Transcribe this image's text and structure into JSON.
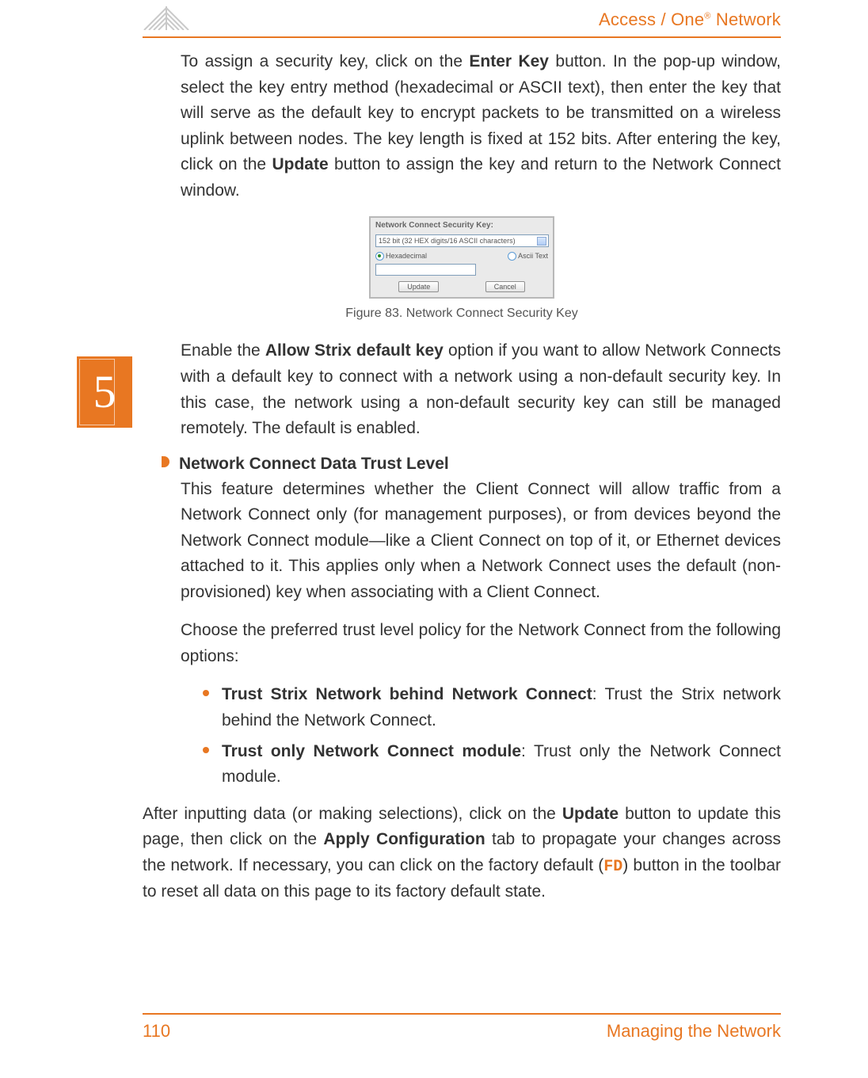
{
  "header": {
    "brand_pre": "Access / One",
    "brand_sup": "®",
    "brand_post": " Network"
  },
  "chapter_tab": "5",
  "p1": {
    "t1": "To assign a security key, click on the ",
    "b1": "Enter Key",
    "t2": " button. In the pop-up window, select the key entry method (hexadecimal or ASCII text), then enter the key that will serve as the default key to encrypt packets to be transmitted on a wireless uplink between nodes. The key length is fixed at 152 bits. After entering the key, click on the ",
    "b2": "Update",
    "t3": " button to assign the key and return to the Network Connect window."
  },
  "dialog": {
    "title": "Network Connect Security Key:",
    "select_text": "152 bit (32 HEX digits/16 ASCII characters)",
    "radio1": "Hexadecimal",
    "radio2": "Ascii Text",
    "btn_update": "Update",
    "btn_cancel": "Cancel"
  },
  "figure_caption": "Figure 83. Network Connect Security Key",
  "p2": {
    "t1": "Enable the ",
    "b1": "Allow Strix default key",
    "t2": " option if you want to allow Network Connects with a default key to connect with a network using a non-default security key. In this case, the network using a non-default security key can still be managed remotely. The default is enabled."
  },
  "bullet_heading": "Network Connect Data Trust Level",
  "p3": "This feature determines whether the Client Connect will allow traffic from a Network Connect only (for management purposes), or from devices beyond the Network Connect module—like a Client Connect on top of it, or Ethernet devices attached to it. This applies only when a Network Connect uses the default (non-provisioned) key when associating with a Client Connect.",
  "p4": "Choose the preferred trust level policy for the Network Connect from the following options:",
  "opt1": {
    "b": "Trust Strix Network behind Network Connect",
    "t": ": Trust the Strix network behind the Network Connect."
  },
  "opt2": {
    "b": "Trust only Network Connect module",
    "t": ": Trust only the Network Connect module."
  },
  "p5": {
    "t1": "After inputting data (or making selections), click on the ",
    "b1": "Update",
    "t2": " button to update this page, then click on the ",
    "b2": "Apply Configuration",
    "t3": " tab to propagate your changes across the network. If necessary, you can click on the factory default (",
    "fd": "FD",
    "t4": ") button in the toolbar to reset all data on this page to its factory default state."
  },
  "footer": {
    "page_no": "110",
    "section": "Managing the Network"
  }
}
